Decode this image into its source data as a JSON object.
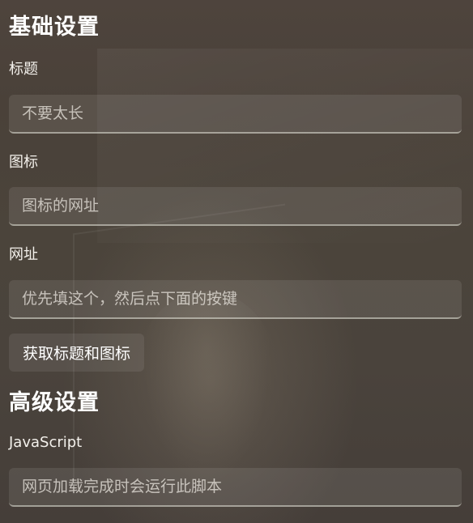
{
  "basic": {
    "title": "基础设置",
    "title_label": "标题",
    "title_placeholder": "不要太长",
    "icon_label": "图标",
    "icon_placeholder": "图标的网址",
    "url_label": "网址",
    "url_placeholder": "优先填这个，然后点下面的按键",
    "fetch_button": "获取标题和图标"
  },
  "advanced": {
    "title": "高级设置",
    "js_label": "JavaScript",
    "js_placeholder": "网页加载完成时会运行此脚本"
  }
}
